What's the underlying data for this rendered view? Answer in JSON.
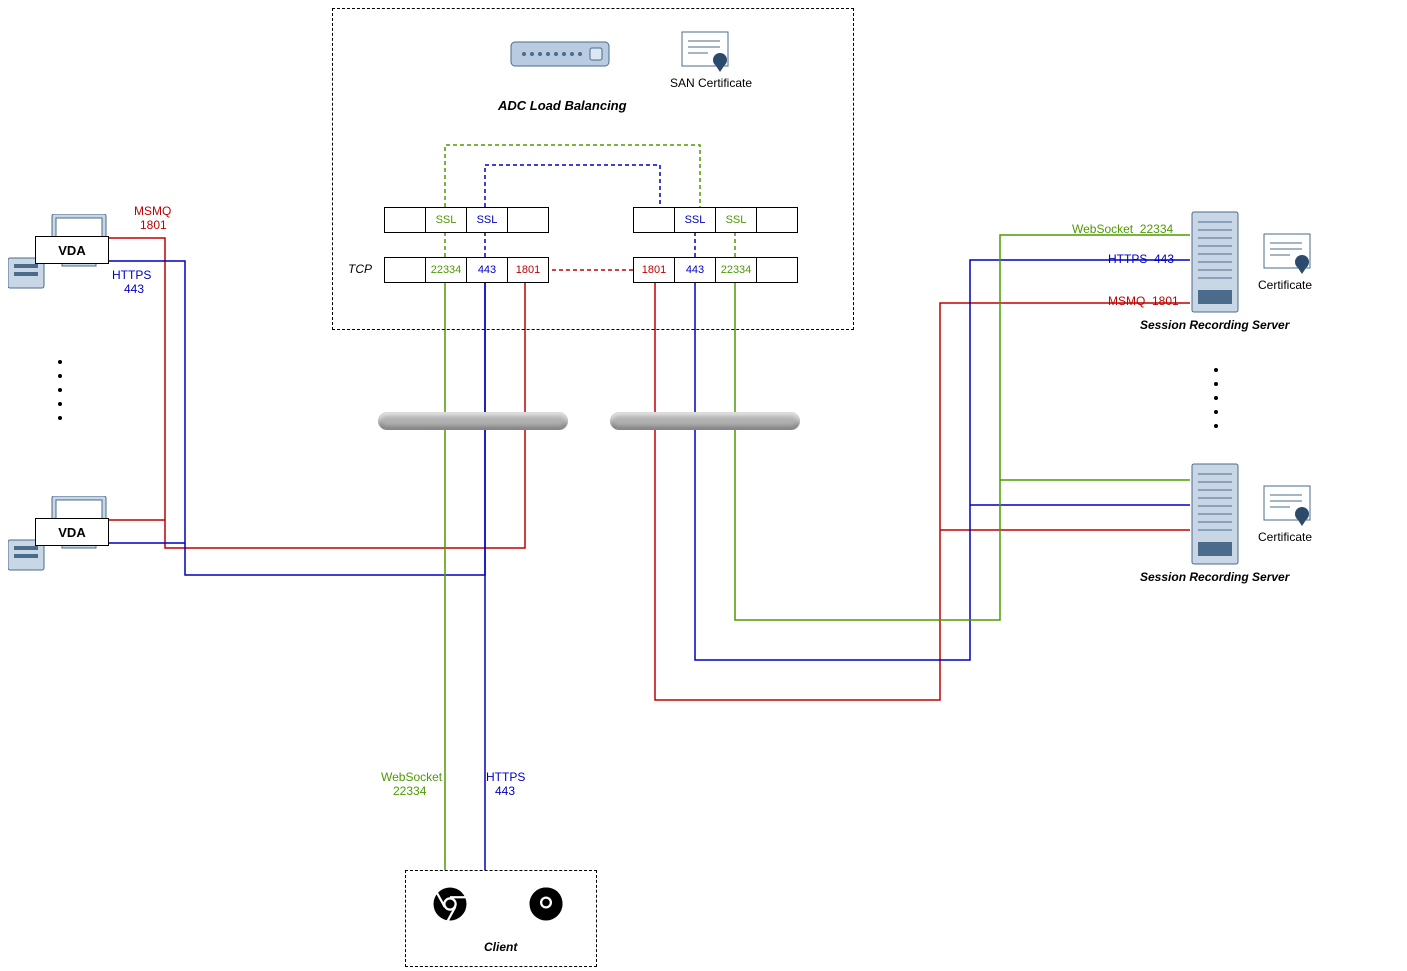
{
  "title_adc": "ADC Load Balancing",
  "san_cert": "SAN Certificate",
  "tcp": "TCP",
  "vda": "VDA",
  "client": "Client",
  "srs": "Session Recording Server",
  "cert": "Certificate",
  "ports": {
    "ssl": "SSL",
    "p22334": "22334",
    "p443": "443",
    "p1801": "1801"
  },
  "labels": {
    "msmq": "MSMQ",
    "l1801": "1801",
    "https": "HTTPS",
    "l443": "443",
    "websocket": "WebSocket",
    "l22334": "22334",
    "ws22334": "WebSocket  22334",
    "https443": "HTTPS  443",
    "msmq1801": "MSMQ  1801"
  },
  "colors": {
    "red": "#c00000",
    "blue": "#0000c0",
    "green": "#4d9a00"
  }
}
